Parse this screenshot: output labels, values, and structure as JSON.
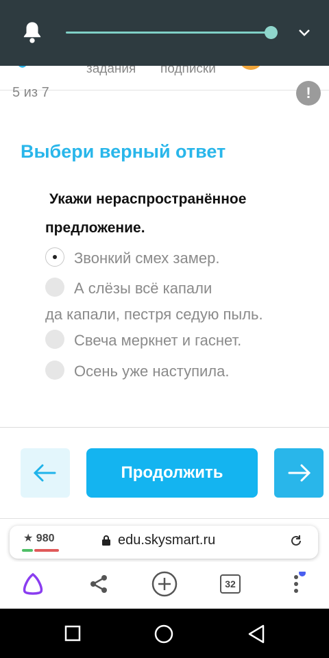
{
  "app": {
    "nav_items": [
      "задания",
      "подписки"
    ]
  },
  "progress": "5 из 7",
  "task": {
    "title": "Выбери верный ответ",
    "question": "Укажи нераспространённое предложение.",
    "options": [
      {
        "lines": [
          "Звонкий смех замер."
        ],
        "selected": true
      },
      {
        "lines": [
          "А слёзы всё капали",
          "да капали, пестря седую пыль."
        ],
        "selected": false
      },
      {
        "lines": [
          "Свеча меркнет и гаснет."
        ],
        "selected": false
      },
      {
        "lines": [
          "Осень уже наступила."
        ],
        "selected": false
      }
    ]
  },
  "buttons": {
    "continue": "Продолжить"
  },
  "browser": {
    "rating": "980",
    "url": "edu.skysmart.ru",
    "tabs_count": "32"
  },
  "colors": {
    "accent": "#14b4f0",
    "title": "#29b6ea",
    "statusbar": "#2e3b40"
  }
}
